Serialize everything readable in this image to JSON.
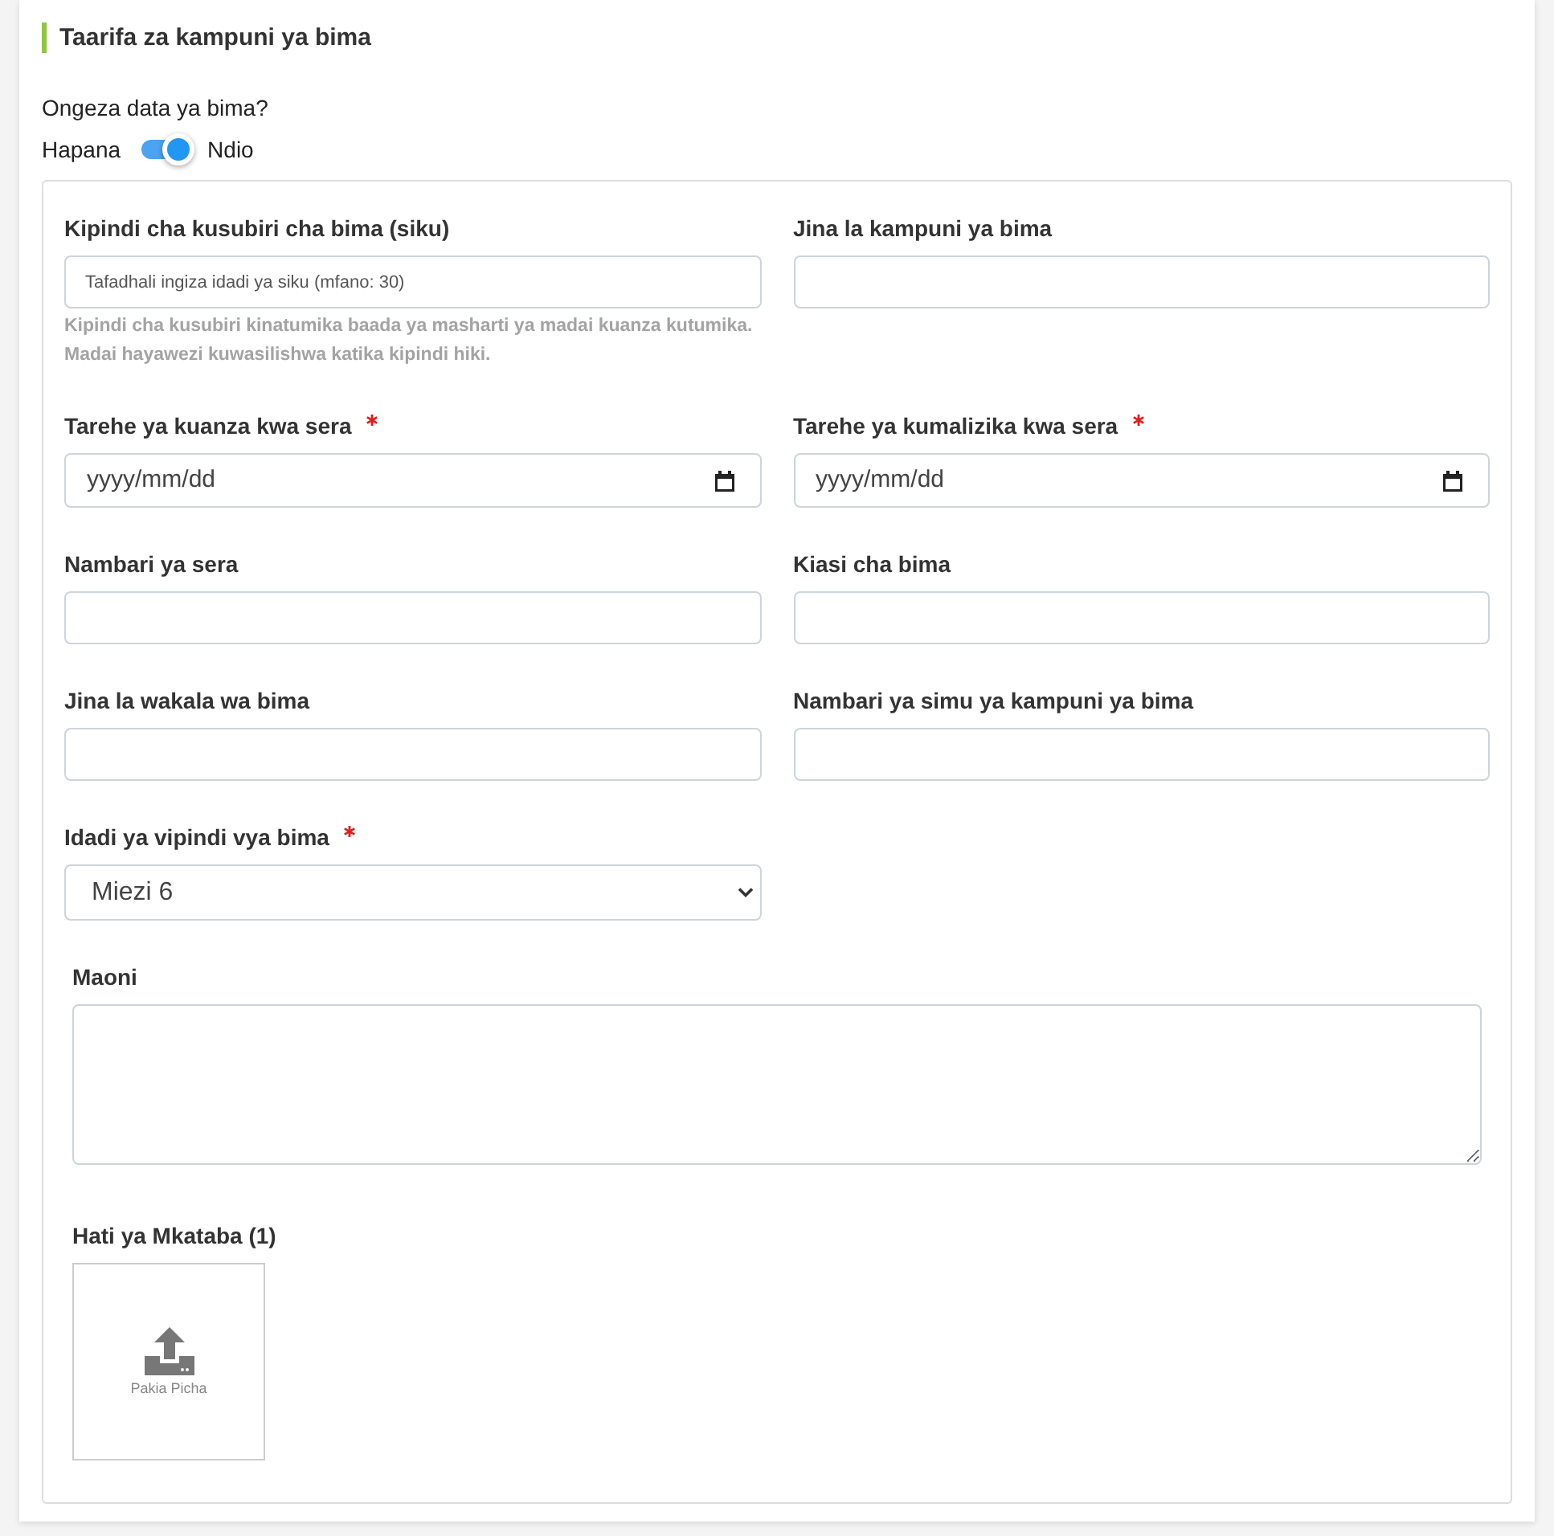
{
  "section": {
    "title": "Taarifa za kampuni ya bima"
  },
  "insurance_toggle": {
    "question": "Ongeza data ya bima?",
    "off_label": "Hapana",
    "on_label": "Ndio",
    "on": true
  },
  "fields": [
    {
      "kind": "text",
      "label": "Kipindi cha kusubiri cha bima (siku)",
      "required": false,
      "placeholder": "Tafadhali ingiza idadi ya siku (mfano: 30)",
      "help": [
        "Kipindi cha kusubiri kinatumika baada ya masharti ya madai kuanza kutumika.",
        "Madai hayawezi kuwasilishwa katika kipindi hiki."
      ]
    },
    {
      "kind": "text",
      "label": "Jina la kampuni ya bima",
      "required": false
    },
    {
      "kind": "date",
      "label": "Tarehe ya kuanza kwa sera",
      "required": true,
      "placeholder": "yyyy/mm/dd"
    },
    {
      "kind": "date",
      "label": "Tarehe ya kumalizika kwa sera",
      "required": true,
      "placeholder": "yyyy/mm/dd"
    },
    {
      "kind": "text",
      "label": "Nambari ya sera",
      "required": false
    },
    {
      "kind": "text",
      "label": "Kiasi cha bima",
      "required": false
    },
    {
      "kind": "text",
      "label": "Jina la wakala wa bima",
      "required": false
    },
    {
      "kind": "text",
      "label": "Nambari ya simu ya kampuni ya bima",
      "required": false
    },
    {
      "kind": "select",
      "label": "Idadi ya vipindi vya bima",
      "required": true,
      "value": "Miezi 6"
    }
  ],
  "comments": {
    "label": "Maoni"
  },
  "attachment": {
    "label": "Hati ya Mkataba (1)",
    "button": "Pakia Picha"
  }
}
